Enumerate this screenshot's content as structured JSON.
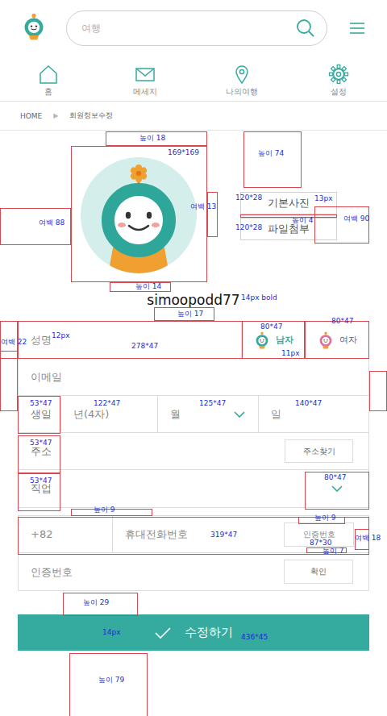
{
  "header": {
    "search_placeholder": "여행"
  },
  "nav": [
    {
      "label": "홈"
    },
    {
      "label": "메세지"
    },
    {
      "label": "나의여행"
    },
    {
      "label": "설정"
    }
  ],
  "breadcrumb": {
    "home": "HOME",
    "separator": "▶",
    "current": "회원정보수정"
  },
  "profile": {
    "buttons": [
      "기본사진",
      "파일첨부"
    ],
    "username": "simoopodd77"
  },
  "form": {
    "name": "성명",
    "gender": [
      {
        "label": "남자",
        "selected": true
      },
      {
        "label": "여자",
        "selected": false
      }
    ],
    "email": "이메일",
    "birthday": {
      "label": "생일",
      "year": "년(4자)",
      "month": "월",
      "day": "일"
    },
    "address": {
      "label": "주소",
      "button": "주소찾기"
    },
    "job": {
      "label": "직업"
    },
    "phone": {
      "prefix": "+82",
      "placeholder": "휴대전화번호",
      "button": "인증번호"
    },
    "code": {
      "placeholder": "인증번호",
      "button": "확인"
    }
  },
  "submit": "수정하기",
  "annotations": [
    {
      "text": "높이 18"
    },
    {
      "text": "169*169"
    },
    {
      "text": "높이 74"
    },
    {
      "text": "120*28"
    },
    {
      "text": "13px"
    },
    {
      "text": "여백 13"
    },
    {
      "text": "높이 4"
    },
    {
      "text": "120*28"
    },
    {
      "text": "여백 88"
    },
    {
      "text": "여백 90"
    },
    {
      "text": "높이 14"
    },
    {
      "text": "14px bold"
    },
    {
      "text": "높이 17"
    },
    {
      "text": "여백 22"
    },
    {
      "text": "12px"
    },
    {
      "text": "278*47"
    },
    {
      "text": "80*47"
    },
    {
      "text": "80*47"
    },
    {
      "text": "11px"
    },
    {
      "text": "53*47"
    },
    {
      "text": "122*47"
    },
    {
      "text": "125*47"
    },
    {
      "text": "140*47"
    },
    {
      "text": "53*47"
    },
    {
      "text": "53*47"
    },
    {
      "text": "80*47"
    },
    {
      "text": "높이 9"
    },
    {
      "text": "높이 9"
    },
    {
      "text": "319*47"
    },
    {
      "text": "87*30"
    },
    {
      "text": "여백 18"
    },
    {
      "text": "높이 7"
    },
    {
      "text": "높이 29"
    },
    {
      "text": "14px"
    },
    {
      "text": "436*45"
    },
    {
      "text": "높이 79"
    }
  ]
}
